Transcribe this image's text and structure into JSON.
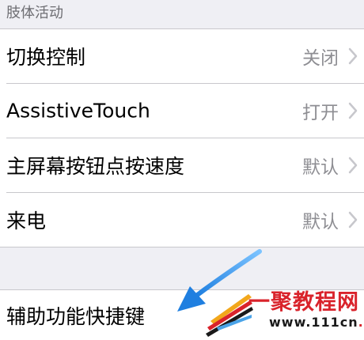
{
  "section_header": "肢体活动",
  "rows": [
    {
      "label": "切换控制",
      "value": "关闭"
    },
    {
      "label": "AssistiveTouch",
      "value": "打开"
    },
    {
      "label": "主屏幕按钮点按速度",
      "value": "默认"
    },
    {
      "label": "来电",
      "value": "默认"
    }
  ],
  "bottom_row": {
    "label": "辅助功能快捷键"
  },
  "watermark": {
    "top_text": "一聚教程网",
    "bottom_prefix": "www.111cn",
    "bottom_dot": ".",
    "bottom_suffix": "net"
  },
  "colors": {
    "background": "#efeff4",
    "cell": "#ffffff",
    "value_text": "#8e8e93",
    "arrow": "#2a8be6",
    "watermark_red": "#d9232b"
  }
}
